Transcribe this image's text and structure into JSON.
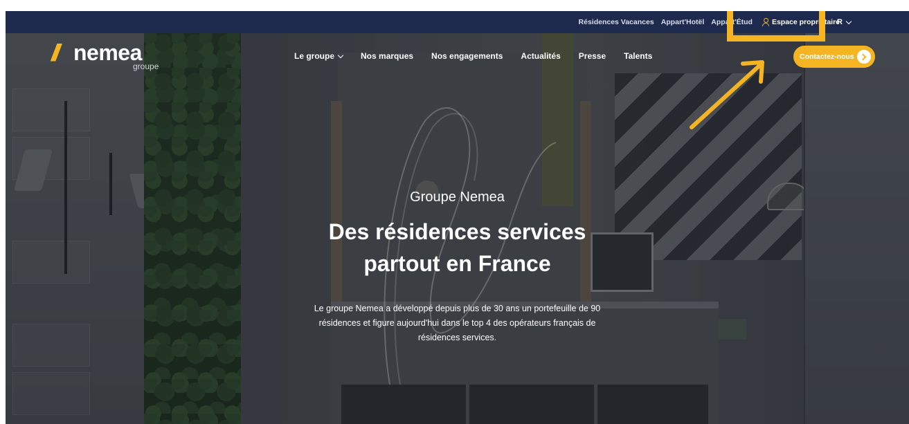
{
  "utility_bar": {
    "links": [
      "Résidences Vacances",
      "Appart'Hotël",
      "Appart'Étud"
    ],
    "owner_link": "Espace propriétaire",
    "language": "R"
  },
  "logo": {
    "brand": "nemea",
    "sub": "groupe"
  },
  "main_nav": {
    "items": [
      "Le groupe",
      "Nos marques",
      "Nos engagements",
      "Actualités",
      "Presse",
      "Talents"
    ]
  },
  "contact_button": "Contactez-nous",
  "hero": {
    "kicker": "Groupe Nemea",
    "title_line1": "Des résidences services",
    "title_line2": "partout en France",
    "description": "Le groupe Nemea a développé depuis plus de 30 ans un portefeuille de 90 résidences et figure aujourd'hui dans le top 4 des opérateurs français de résidences services."
  },
  "colors": {
    "accent": "#f5b523",
    "navy": "#1e2a4d"
  }
}
